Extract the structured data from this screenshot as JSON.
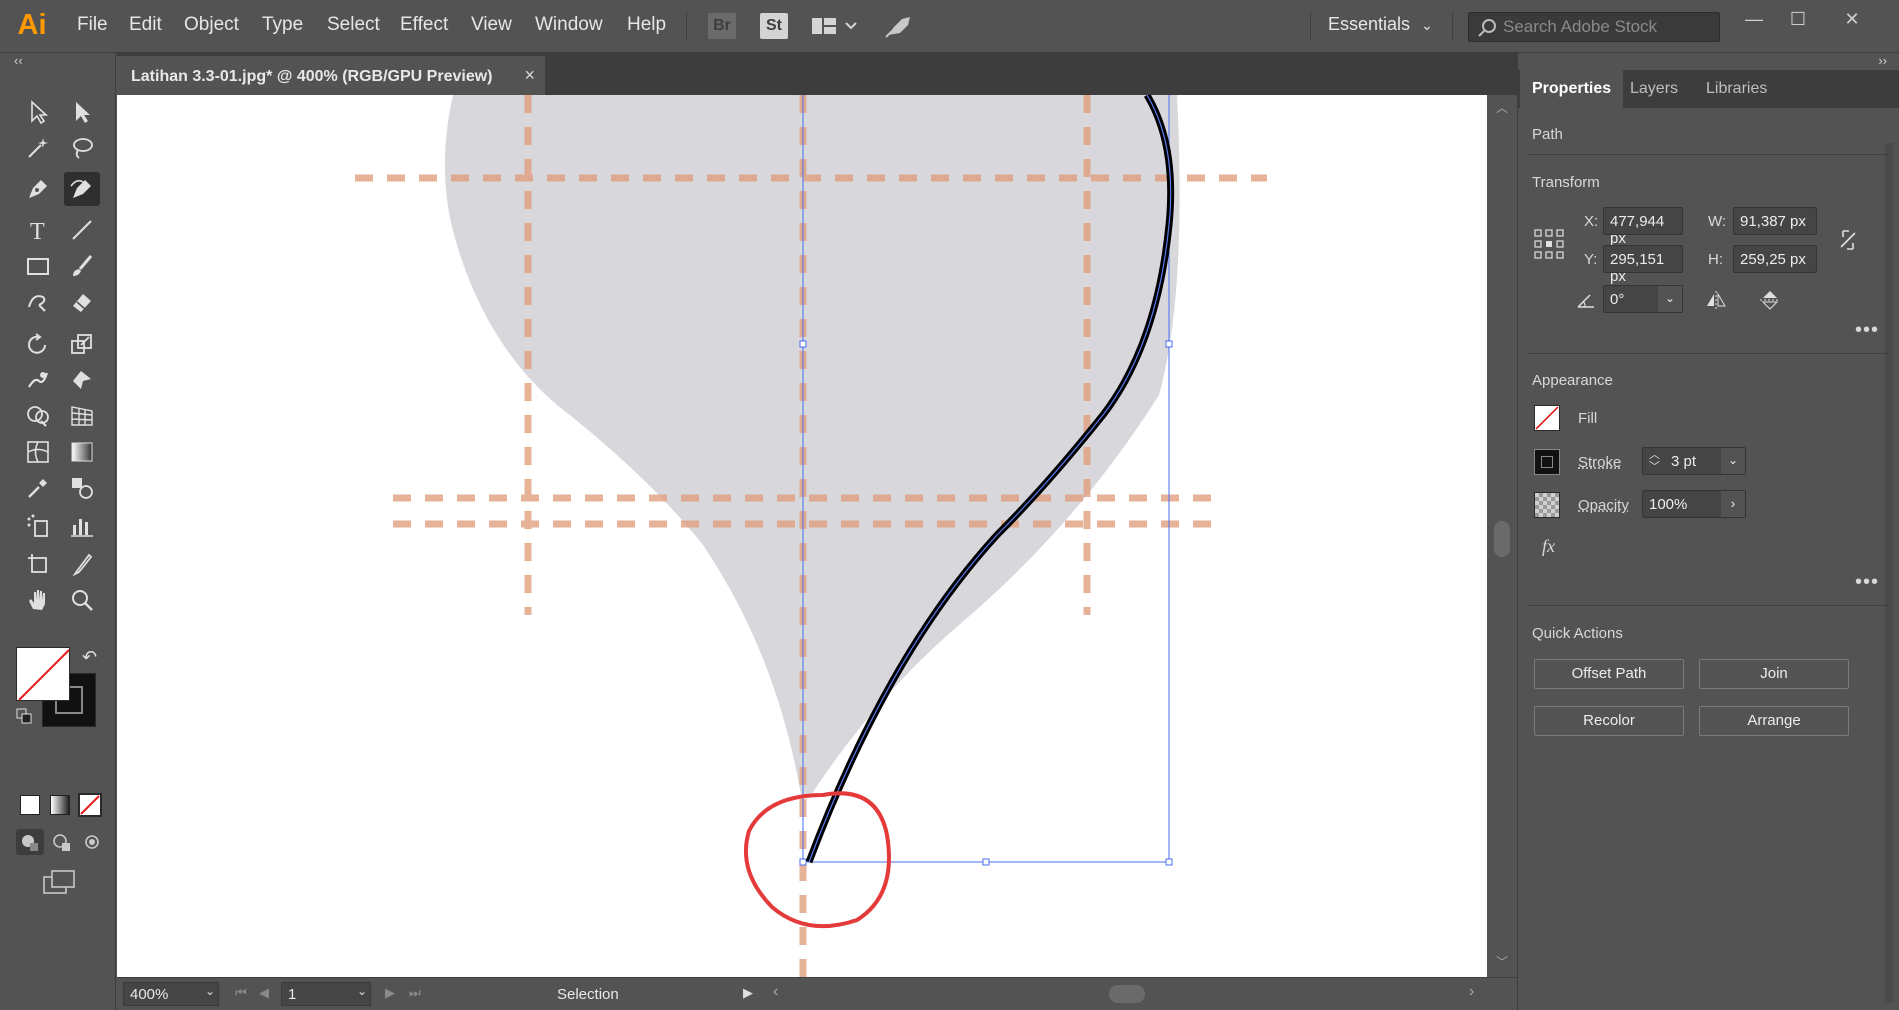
{
  "app": {
    "logo": "Ai",
    "menu": [
      "File",
      "Edit",
      "Object",
      "Type",
      "Select",
      "Effect",
      "View",
      "Window",
      "Help"
    ],
    "bridge_label": "Br",
    "stock_label": "St",
    "workspace": "Essentials",
    "search": {
      "placeholder": "Search Adobe Stock"
    },
    "accent_color": "#ff9a00"
  },
  "document": {
    "tab_title": "Latihan 3.3-01.jpg* @ 400% (RGB/GPU Preview)",
    "close_glyph": "×"
  },
  "toolbar": {
    "tools": [
      "selection",
      "direct-selection",
      "magic-wand",
      "lasso",
      "pen",
      "curvature",
      "type",
      "line-segment",
      "rectangle",
      "paintbrush",
      "shaper",
      "eraser",
      "rotate",
      "scale",
      "warp",
      "free-transform",
      "shape-builder",
      "perspective-grid",
      "mesh",
      "gradient",
      "eyedropper",
      "blend",
      "symbol-sprayer",
      "column-graph",
      "artboard",
      "slice",
      "hand",
      "zoom"
    ],
    "active_tool": "curvature"
  },
  "status": {
    "zoom": "400%",
    "page": "1",
    "tool": "Selection"
  },
  "panel": {
    "tabs": [
      "Properties",
      "Layers",
      "Libraries"
    ],
    "selection_type": "Path",
    "transform": {
      "title": "Transform",
      "x_label": "X:",
      "x": "477,944 px",
      "y_label": "Y:",
      "y": "295,151 px",
      "w_label": "W:",
      "w": "91,387 px",
      "h_label": "H:",
      "h": "259,25 px",
      "rotate": "0°"
    },
    "appearance": {
      "title": "Appearance",
      "fill_label": "Fill",
      "stroke_label": "Stroke",
      "stroke_weight": "3 pt",
      "opacity_label": "Opacity",
      "opacity": "100%",
      "fx_label": "fx"
    },
    "quick_actions": {
      "title": "Quick Actions",
      "buttons": [
        "Offset Path",
        "Join",
        "Recolor",
        "Arrange"
      ]
    }
  }
}
